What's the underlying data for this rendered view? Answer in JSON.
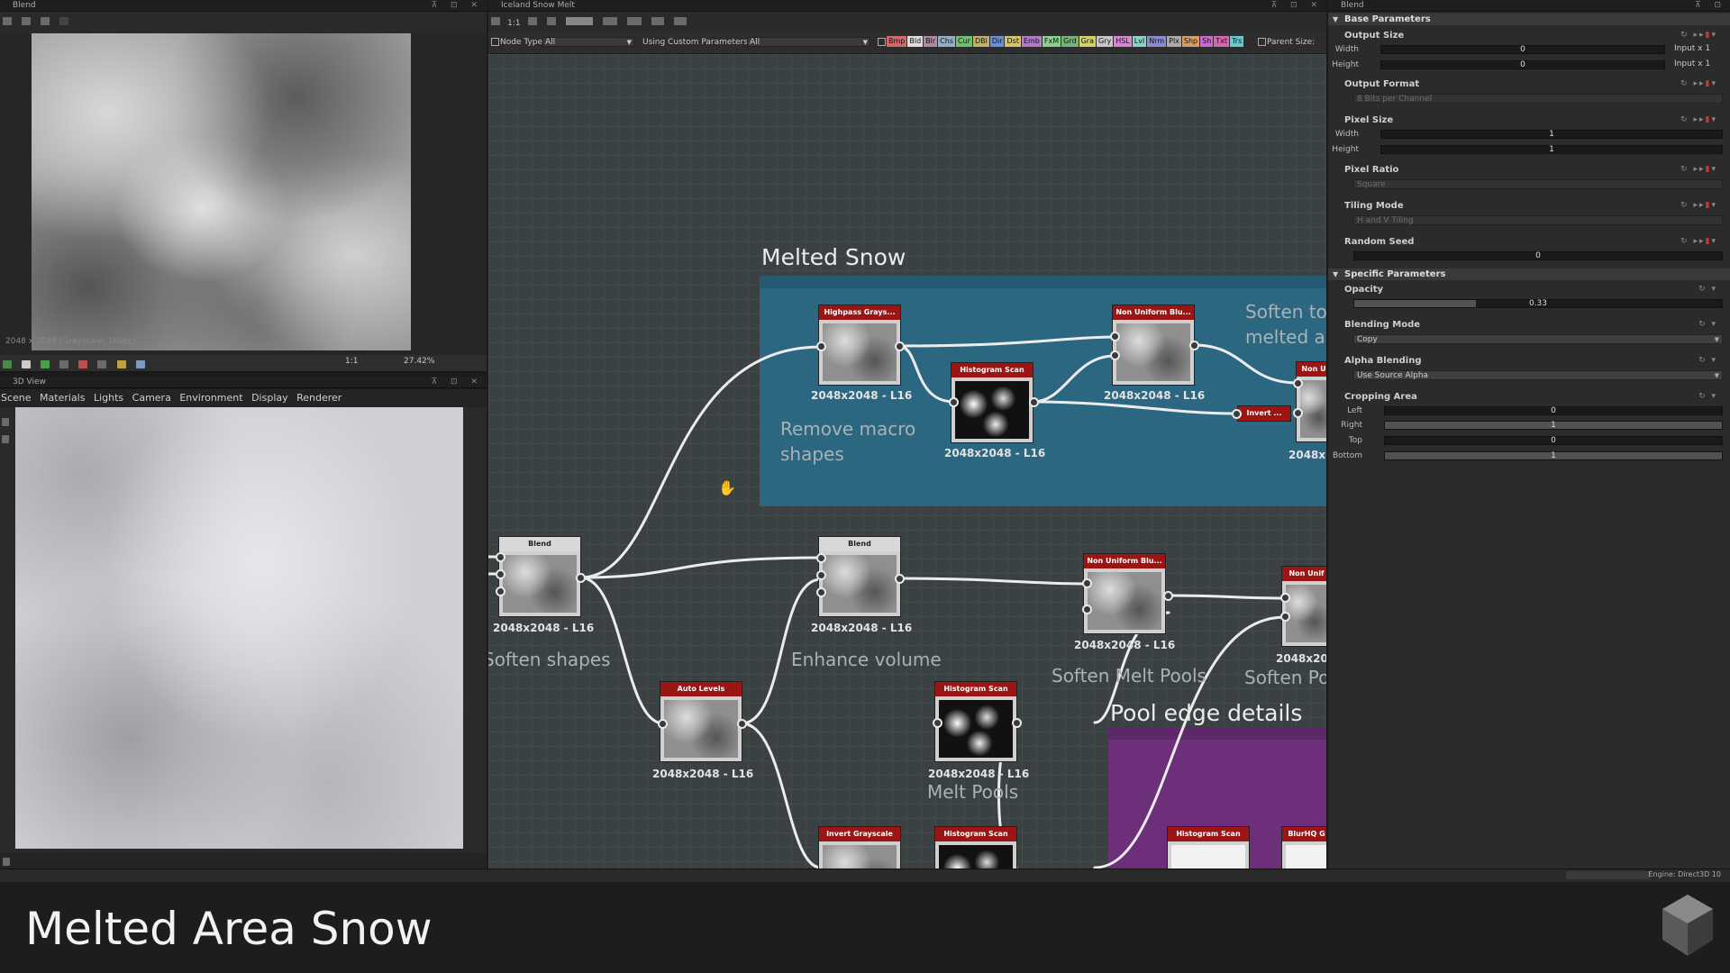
{
  "panels": {
    "p2d": {
      "title": "Blend",
      "info": "2048 x 2048 (Grayscale, 16bpc)",
      "zoom": "27.42%",
      "ratio": "1:1"
    },
    "p3d": {
      "title": "3D View",
      "menu": [
        "Scene",
        "Materials",
        "Lights",
        "Camera",
        "Environment",
        "Display",
        "Renderer"
      ]
    },
    "graph": {
      "title": "Iceland Snow Melt",
      "ratio": "1:1"
    },
    "props": {
      "title": "Blend"
    }
  },
  "graph_toolbar": {
    "node_type_label": "Node Type",
    "node_type_value": "All",
    "custom_label": "Using Custom Parameters",
    "custom_value": "All",
    "parent_size": "Parent Size:",
    "chips": [
      {
        "label": "Bmp",
        "color": "#d36a6a"
      },
      {
        "label": "Bld",
        "color": "#dddddd"
      },
      {
        "label": "Blr",
        "color": "#b08aa0"
      },
      {
        "label": "Chs",
        "color": "#8fb0c6"
      },
      {
        "label": "Cur",
        "color": "#6fbf6f"
      },
      {
        "label": "DBl",
        "color": "#c0b26a"
      },
      {
        "label": "Dir",
        "color": "#6a8fd3"
      },
      {
        "label": "Dst",
        "color": "#d3c36a"
      },
      {
        "label": "Emb",
        "color": "#b27ac8"
      },
      {
        "label": "FxM",
        "color": "#8ad38a"
      },
      {
        "label": "Grd",
        "color": "#7ab07a"
      },
      {
        "label": "Gra",
        "color": "#d3d36a"
      },
      {
        "label": "Gry",
        "color": "#c8c8c8"
      },
      {
        "label": "HSL",
        "color": "#d38ad3"
      },
      {
        "label": "Lvl",
        "color": "#8ad3c8"
      },
      {
        "label": "Nrm",
        "color": "#8a8ad3"
      },
      {
        "label": "Plx",
        "color": "#aaaaaa"
      },
      {
        "label": "Shp",
        "color": "#d3a06a"
      },
      {
        "label": "Sh",
        "color": "#c86ad3"
      },
      {
        "label": "Txt",
        "color": "#d36ab0"
      },
      {
        "label": "Trs",
        "color": "#6ac8d3"
      }
    ]
  },
  "frames": {
    "melted": {
      "title": "Melted Snow",
      "color": "#2c6782"
    },
    "pool": {
      "title": "Pool edge details",
      "color": "#6d2f7a"
    }
  },
  "comments": {
    "remove_macro": "Remove macro\nshapes",
    "soften_to": "Soften to\nmelted a",
    "soften_shapes": "Soften shapes",
    "enhance_volume": "Enhance volume",
    "soften_melt_pools": "Soften Melt Pools",
    "soften_p": "Soften Po",
    "melt_pools": "Melt Pools"
  },
  "nodes": [
    {
      "id": "highpass",
      "title": "Highpass Grays...",
      "size": "2048x2048 - L16"
    },
    {
      "id": "histo1",
      "title": "Histogram Scan",
      "size": "2048x2048 - L16"
    },
    {
      "id": "nonuni1",
      "title": "Non Uniform Blu...",
      "size": "2048x2048 - L16"
    },
    {
      "id": "nonuni2",
      "title": "Non U",
      "size": "2048x2"
    },
    {
      "id": "invert1",
      "title": "Invert ..."
    },
    {
      "id": "blend1",
      "title": "Blend",
      "size": "2048x2048 - L16"
    },
    {
      "id": "blend2",
      "title": "Blend",
      "size": "2048x2048 - L16"
    },
    {
      "id": "nonuni3",
      "title": "Non Uniform Blu...",
      "size": "2048x2048 - L16"
    },
    {
      "id": "nonuni4",
      "title": "Non Unif",
      "size": "2048x20"
    },
    {
      "id": "autolevels",
      "title": "Auto Levels",
      "size": "2048x2048 - L16"
    },
    {
      "id": "histo2",
      "title": "Histogram Scan",
      "size": "2048x2048 - L16"
    },
    {
      "id": "invertgray",
      "title": "Invert Grayscale"
    },
    {
      "id": "histo3",
      "title": "Histogram Scan"
    },
    {
      "id": "histo4",
      "title": "Histogram Scan"
    },
    {
      "id": "blurhq",
      "title": "BlurHQ G"
    }
  ],
  "props": {
    "base_section": "Base Parameters",
    "specific_section": "Specific Parameters",
    "output_size": {
      "label": "Output Size",
      "width_label": "Width",
      "width_value": "0",
      "width_extra": "Input x 1",
      "height_label": "Height",
      "height_value": "0",
      "height_extra": "Input x 1"
    },
    "output_format": {
      "label": "Output Format",
      "value": "8 Bits per Channel"
    },
    "pixel_size": {
      "label": "Pixel Size",
      "width_label": "Width",
      "width_value": "1",
      "height_label": "Height",
      "height_value": "1"
    },
    "pixel_ratio": {
      "label": "Pixel Ratio",
      "value": "Square"
    },
    "tiling_mode": {
      "label": "Tiling Mode",
      "value": "H and V Tiling"
    },
    "random_seed": {
      "label": "Random Seed",
      "value": "0"
    },
    "opacity": {
      "label": "Opacity",
      "value": "0.33",
      "fraction": 0.33
    },
    "blending_mode": {
      "label": "Blending Mode",
      "value": "Copy"
    },
    "alpha_blending": {
      "label": "Alpha Blending",
      "value": "Use Source Alpha"
    },
    "cropping": {
      "label": "Cropping Area",
      "left_label": "Left",
      "left_value": "0",
      "right_label": "Right",
      "right_value": "1",
      "top_label": "Top",
      "top_value": "0",
      "bottom_label": "Bottom",
      "bottom_value": "1"
    }
  },
  "status": {
    "engine": "Engine: Direct3D 10"
  },
  "caption": "Melted Area Snow"
}
